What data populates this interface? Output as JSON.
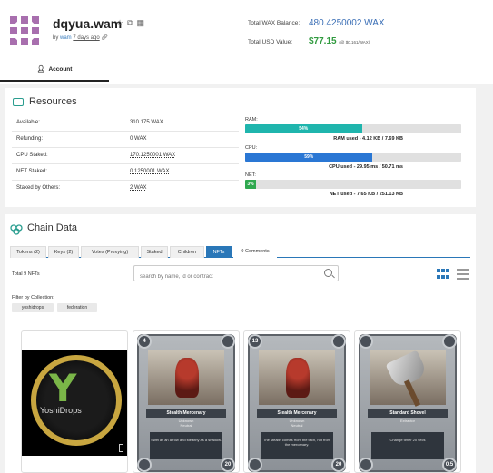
{
  "account": {
    "name": "dqyua.wam",
    "created_by_prefix": "by",
    "created_by": "wam",
    "created_age": "7 days ago",
    "icons": [
      "star-icon",
      "copy-icon",
      "qr-icon",
      "link-icon"
    ]
  },
  "balances": {
    "total_wax_label": "Total WAX Balance:",
    "total_wax_value": "480.4250002 WAX",
    "total_usd_label": "Total USD Value:",
    "total_usd_value": "$77.15",
    "total_usd_rate": "(@ $0.161/WAX)"
  },
  "tabs_top": {
    "account_label": "Account"
  },
  "resources": {
    "title": "Resources",
    "rows": [
      {
        "label": "Available:",
        "value": "310.175 WAX"
      },
      {
        "label": "Refunding:",
        "value": "0 WAX"
      },
      {
        "label": "CPU Staked:",
        "value": "170.1250001 WAX"
      },
      {
        "label": "NET Staked:",
        "value": "0.1250001 WAX"
      },
      {
        "label": "Staked by Others:",
        "value": "2 WAX"
      }
    ],
    "ram": {
      "label": "RAM:",
      "percent_text": "54%",
      "percent": 54,
      "caption": "RAM used - 4.12 KB / 7.69 KB",
      "color": "#1fb5ad"
    },
    "cpu": {
      "label": "CPU:",
      "percent_text": "59%",
      "percent": 59,
      "caption": "CPU used - 29.95 ms / 50.71 ms",
      "color": "#2a77d4"
    },
    "net": {
      "label": "NET:",
      "percent_text": "3%",
      "percent": 3,
      "caption": "NET used - 7.65 KB / 251.13 KB",
      "color": "#2fa84f"
    }
  },
  "chain": {
    "title": "Chain Data",
    "tabs": [
      "Tokens (2)",
      "Keys (2)",
      "Votes (Proxying)",
      "Staked",
      "Children",
      "NFTs",
      "0 Comments"
    ],
    "active_tab": "NFTs",
    "total_nfts": "Total 9 NFTs",
    "search_placeholder": "search by name, id or contract",
    "filter_label": "Filter by Collection:",
    "collections": [
      "yoshidrops",
      "federation"
    ],
    "nfts": [
      {
        "type": "logo",
        "text": "YoshiDrops"
      },
      {
        "type": "card",
        "name": "Stealth Mercenary",
        "sub1": "Unknown",
        "sub2": "Neutral",
        "desc": "Swift as an arrow and stealthy as a shadow.",
        "tl": "4",
        "tr": "",
        "bl": "",
        "br": "20"
      },
      {
        "type": "card",
        "name": "Stealth Mercenary",
        "sub1": "Unknown",
        "sub2": "Neutral",
        "desc": "The stealth comes from the tech, not from the mercenary.",
        "tl": "13",
        "tr": "",
        "bl": "",
        "br": "20"
      },
      {
        "type": "card",
        "name": "Standard Shovel",
        "sub1": "Extractor",
        "sub2": "",
        "desc": "Change timer 20 secs",
        "tl": "",
        "tr": "",
        "bl": "",
        "br": "0.5"
      }
    ]
  },
  "colors": {
    "accent": "#2a77b8",
    "teal": "#2a9d8f",
    "avatar": "#a86fae"
  }
}
